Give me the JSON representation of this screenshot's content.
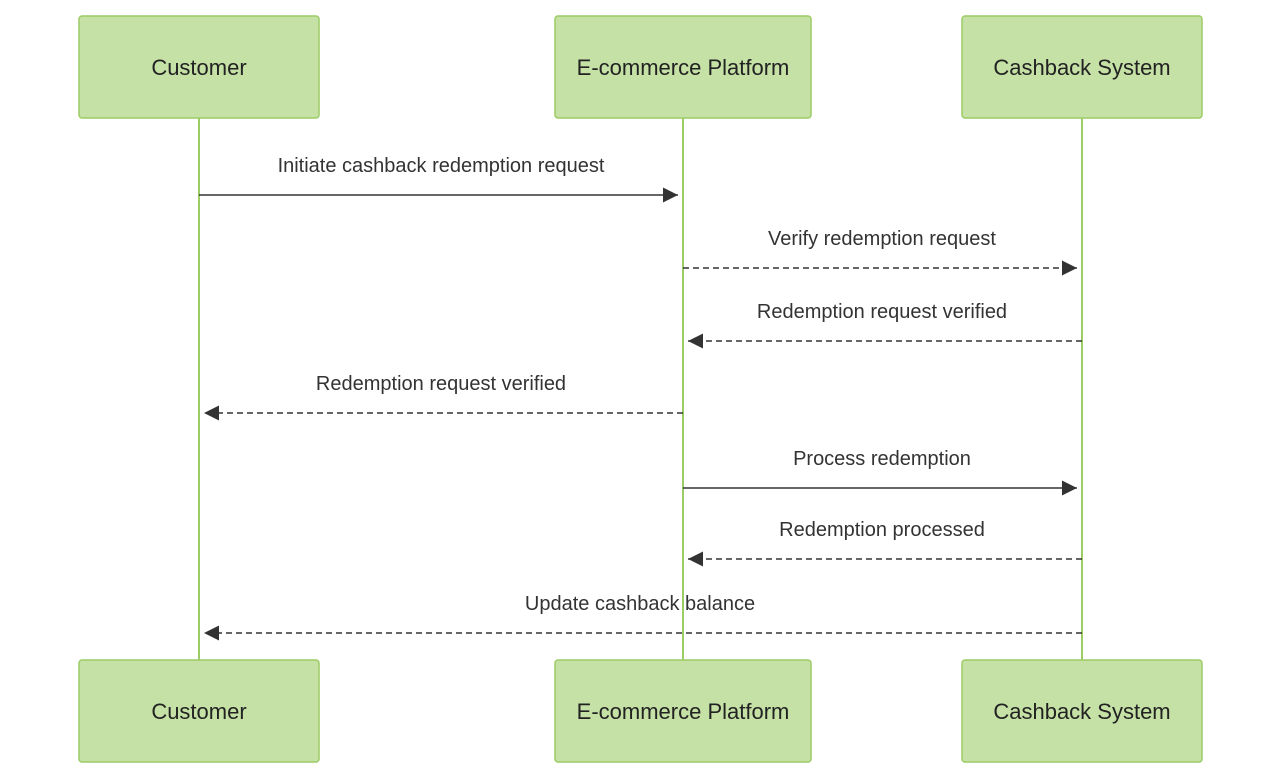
{
  "diagram": {
    "type": "sequence",
    "actors": [
      {
        "id": "customer",
        "label": "Customer"
      },
      {
        "id": "ecommerce",
        "label": "E-commerce Platform"
      },
      {
        "id": "cashback",
        "label": "Cashback System"
      }
    ],
    "messages": [
      {
        "from": "customer",
        "to": "ecommerce",
        "label": "Initiate cashback redemption request",
        "style": "solid"
      },
      {
        "from": "ecommerce",
        "to": "cashback",
        "label": "Verify redemption request",
        "style": "dashed"
      },
      {
        "from": "cashback",
        "to": "ecommerce",
        "label": "Redemption request verified",
        "style": "dashed"
      },
      {
        "from": "ecommerce",
        "to": "customer",
        "label": "Redemption request verified",
        "style": "dashed"
      },
      {
        "from": "ecommerce",
        "to": "cashback",
        "label": "Process redemption",
        "style": "solid"
      },
      {
        "from": "cashback",
        "to": "ecommerce",
        "label": "Redemption processed",
        "style": "dashed"
      },
      {
        "from": "cashback",
        "to": "customer",
        "label": "Update cashback balance",
        "style": "dashed"
      }
    ]
  }
}
